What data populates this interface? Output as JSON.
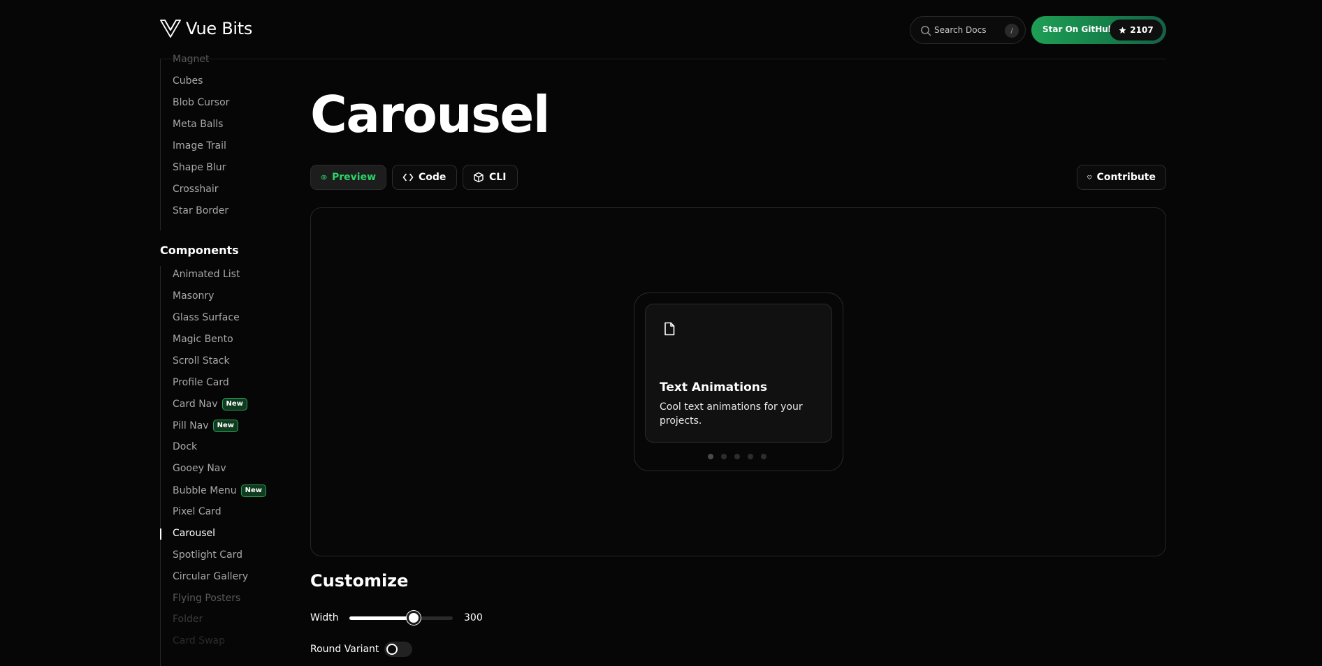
{
  "header": {
    "logo_text": "Vue Bits",
    "search_placeholder": "Search Docs",
    "search_shortcut": "/",
    "github_label": "Star On GitHub",
    "github_stars": "2107"
  },
  "sidebar": {
    "animations": [
      {
        "label": "Magnet",
        "state": "fade1"
      },
      {
        "label": "Cubes"
      },
      {
        "label": "Blob Cursor"
      },
      {
        "label": "Meta Balls"
      },
      {
        "label": "Image Trail"
      },
      {
        "label": "Shape Blur"
      },
      {
        "label": "Crosshair"
      },
      {
        "label": "Star Border"
      }
    ],
    "components_heading": "Components",
    "components": [
      {
        "label": "Animated List"
      },
      {
        "label": "Masonry"
      },
      {
        "label": "Glass Surface"
      },
      {
        "label": "Magic Bento"
      },
      {
        "label": "Scroll Stack"
      },
      {
        "label": "Profile Card"
      },
      {
        "label": "Card Nav",
        "badge": "New"
      },
      {
        "label": "Pill Nav",
        "badge": "New"
      },
      {
        "label": "Dock"
      },
      {
        "label": "Gooey Nav"
      },
      {
        "label": "Bubble Menu",
        "badge": "New"
      },
      {
        "label": "Pixel Card"
      },
      {
        "label": "Carousel",
        "state": "active"
      },
      {
        "label": "Spotlight Card"
      },
      {
        "label": "Circular Gallery"
      },
      {
        "label": "Flying Posters",
        "state": "fade1"
      },
      {
        "label": "Folder",
        "state": "fade2"
      },
      {
        "label": "Card Swap",
        "state": "fade3"
      }
    ]
  },
  "main": {
    "title": "Carousel",
    "tabs": {
      "preview": "Preview",
      "code": "Code",
      "cli": "CLI",
      "contribute": "Contribute"
    },
    "carousel": {
      "card_title": "Text Animations",
      "card_desc": "Cool text animations for your projects.",
      "dot_count": 5,
      "active_dot": 0
    },
    "customize": {
      "heading": "Customize",
      "width_label": "Width",
      "width_value": "300",
      "width_fraction": 0.62,
      "round_label": "Round Variant",
      "round_on": false
    }
  },
  "colors": {
    "accent_green": "#2bd466",
    "background": "#060606"
  }
}
